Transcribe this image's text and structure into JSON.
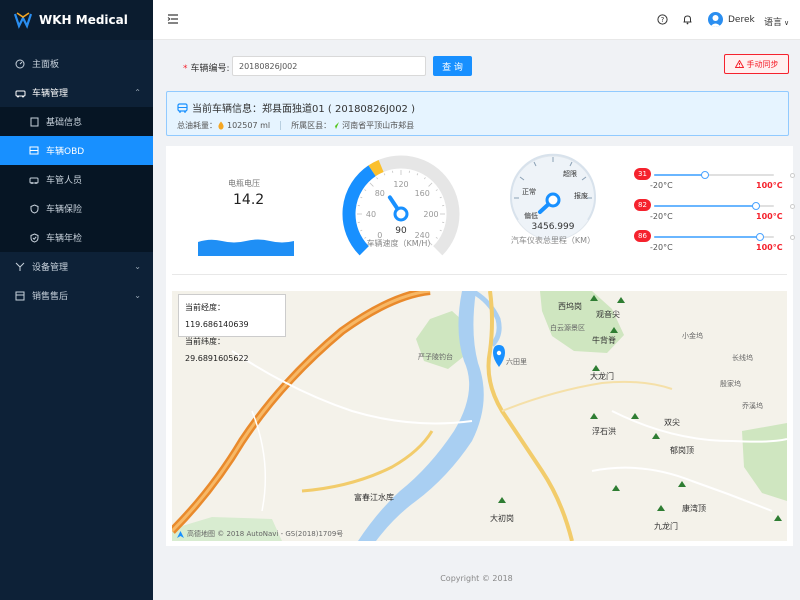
{
  "app": {
    "brand": "WKH Medical"
  },
  "sidebar": {
    "items": [
      {
        "label": "主面板",
        "icon": "dashboard-icon"
      },
      {
        "label": "车辆管理",
        "icon": "car-icon",
        "expanded": true,
        "children": [
          {
            "label": "基础信息",
            "icon": "doc-icon"
          },
          {
            "label": "车辆OBD",
            "icon": "obd-icon",
            "active": true
          },
          {
            "label": "车管人员",
            "icon": "user-icon"
          },
          {
            "label": "车辆保险",
            "icon": "shield-icon"
          },
          {
            "label": "车辆年检",
            "icon": "check-shield-icon"
          }
        ]
      },
      {
        "label": "设备管理",
        "icon": "device-icon"
      },
      {
        "label": "销售售后",
        "icon": "sales-icon"
      }
    ]
  },
  "header": {
    "user": "Derek",
    "language": "语言"
  },
  "search": {
    "label": "车辆编号:",
    "value": "20180826J002",
    "button": "查 询"
  },
  "sync_button": "手动同步",
  "vehicle": {
    "title": "当前车辆信息：郑县面独道01 ( 20180826J002 )",
    "fuel_label": "总油耗量：",
    "fuel_value": "102507 ml",
    "area_label": "所属区县：",
    "area_value": "河南省平顶山市郏县"
  },
  "voltage": {
    "label": "电瓶电压",
    "value": "14.2"
  },
  "speed_gauge": {
    "label": "车辆速度（KM/H）",
    "value": 90,
    "min": 0,
    "max": 240,
    "display": "90",
    "ticks": [
      "0",
      "40",
      "80",
      "120",
      "160",
      "200",
      "240"
    ]
  },
  "odometer": {
    "label": "汽车仪表总里程（KM）",
    "value": "3456.999",
    "zones": [
      "偏低",
      "正常",
      "超限",
      "报废"
    ]
  },
  "temperatures": [
    {
      "badge": "31",
      "min": "-20°C",
      "max": "100°C",
      "value": 31
    },
    {
      "badge": "82",
      "min": "-20°C",
      "max": "100°C",
      "value": 82
    },
    {
      "badge": "86",
      "min": "-20°C",
      "max": "100°C",
      "value": 86
    }
  ],
  "map": {
    "lng_label": "当前经度：",
    "lng": "119.686140639",
    "lat_label": "当前纬度：",
    "lat": "29.6891605622",
    "attribution": "高德地图 © 2018 AutoNavi - GS(2018)1709号",
    "places": [
      "西坞岗",
      "观音尖",
      "白云源景区",
      "牛背脊",
      "大龙门",
      "浮石洪",
      "郁岗顶",
      "康湾顶",
      "九龙门",
      "大初岗",
      "富春江水库",
      "严子陵钓台",
      "六田里",
      "小金坞",
      "双尖",
      "殷家坞",
      "乔溪坞",
      "长线坞"
    ]
  },
  "footer": {
    "copyright": "Copyright © 2018"
  }
}
